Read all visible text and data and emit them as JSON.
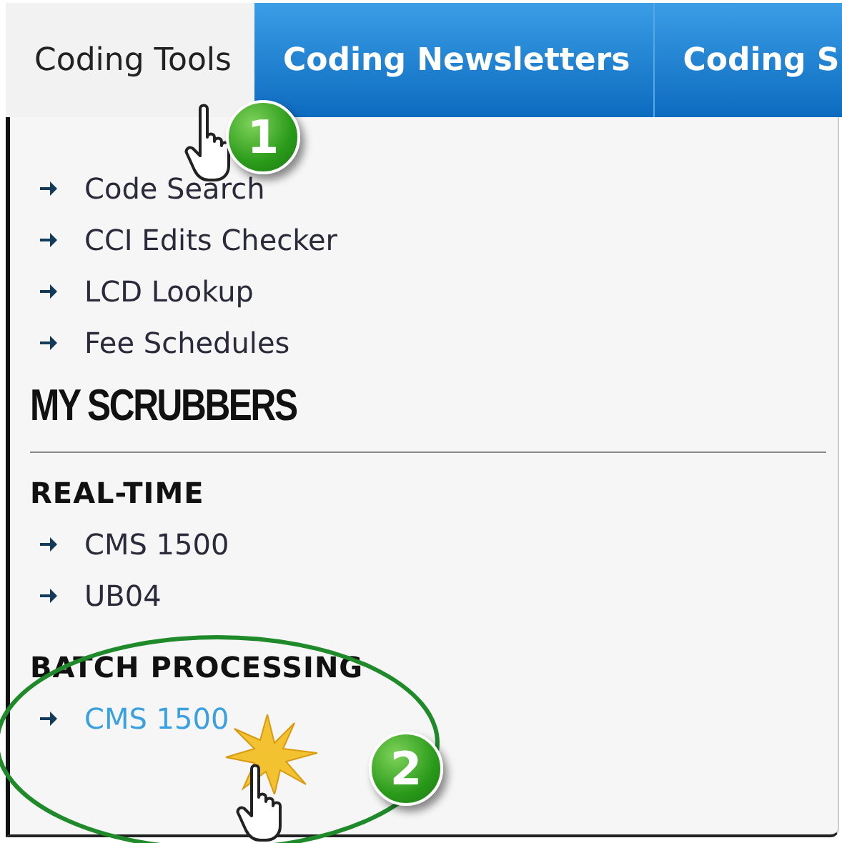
{
  "tabs": [
    {
      "label": "Coding Tools",
      "selected": true
    },
    {
      "label": "Coding Newsletters",
      "selected": false
    },
    {
      "label": "Coding S",
      "selected": false
    }
  ],
  "tools": [
    {
      "label": "Code Search",
      "selected": false
    },
    {
      "label": "CCI Edits Checker",
      "selected": false
    },
    {
      "label": "LCD Lookup",
      "selected": false
    },
    {
      "label": "Fee Schedules",
      "selected": false
    }
  ],
  "heading": "MY SCRUBBERS",
  "groups": [
    {
      "title": "REAL-TIME",
      "items": [
        {
          "label": "CMS 1500",
          "selected": false
        },
        {
          "label": "UB04",
          "selected": false
        }
      ]
    },
    {
      "title": "BATCH PROCESSING",
      "items": [
        {
          "label": "CMS 1500",
          "selected": true
        }
      ]
    }
  ],
  "step_badges": [
    {
      "label": "1"
    },
    {
      "label": "2"
    }
  ]
}
